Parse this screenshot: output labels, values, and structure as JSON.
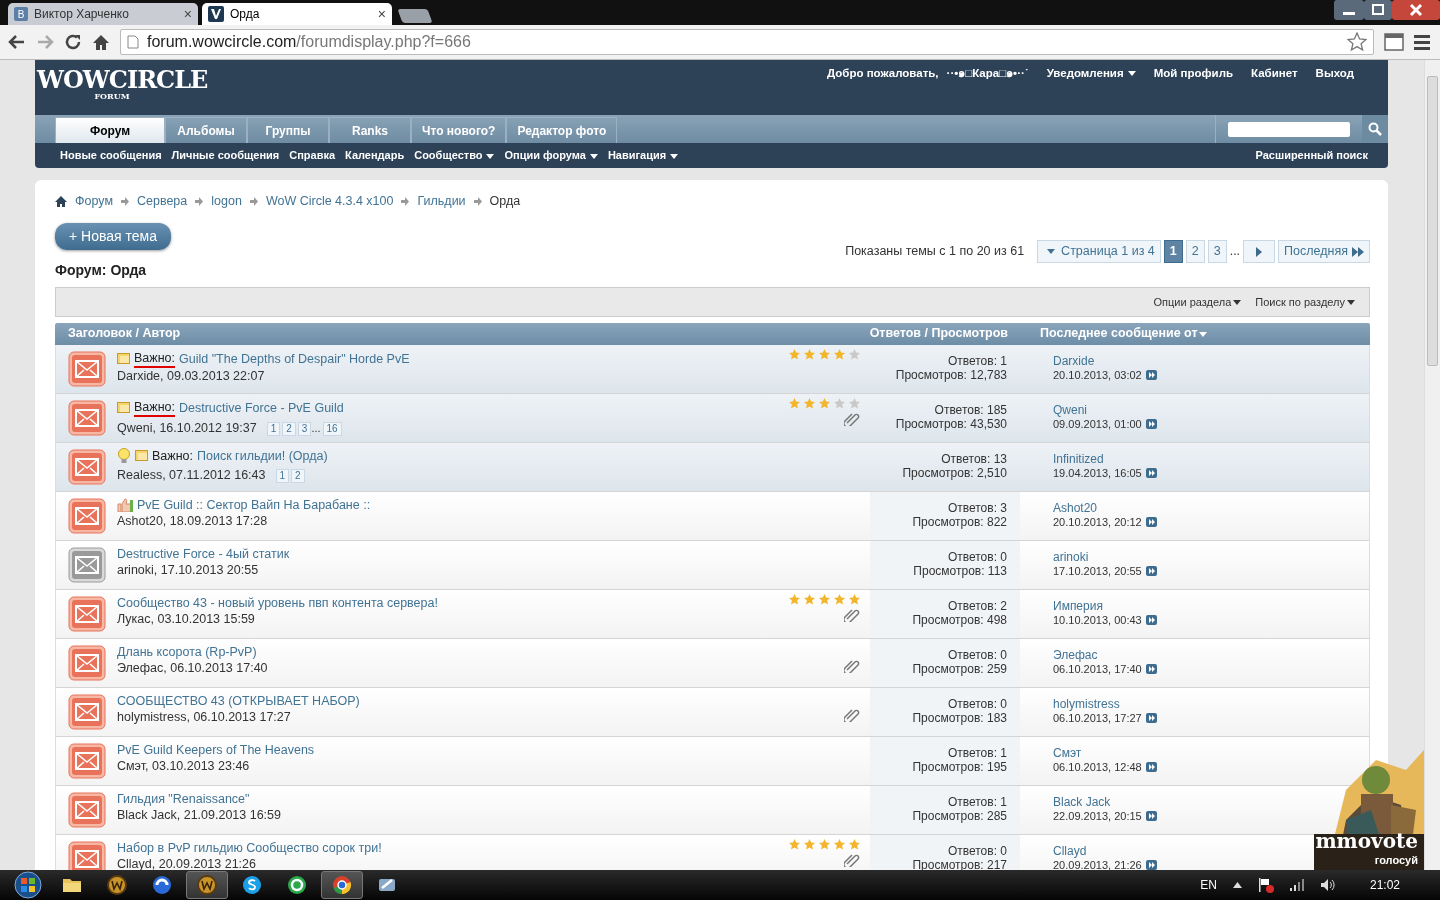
{
  "browser": {
    "tabs": [
      {
        "title": "Виктор Харченко",
        "icon_letter": "В",
        "selected": false
      },
      {
        "title": "Орда",
        "selected": true
      }
    ],
    "close_mark": "×",
    "url": {
      "host": "forum.wowcircle.com",
      "path": "/forumdisplay.php?f=666"
    }
  },
  "header": {
    "logo": "WOWCIRCLE",
    "logo_sub": "FORUM",
    "welcome": "Добро пожаловать,",
    "username": "··•๑□Кара□๑•··˙",
    "links": [
      {
        "label": "Уведомления",
        "dropdown": true
      },
      {
        "label": "Мой профиль",
        "dropdown": false
      },
      {
        "label": "Кабинет",
        "dropdown": false
      },
      {
        "label": "Выход",
        "dropdown": false
      }
    ]
  },
  "nav_tabs": [
    {
      "label": "Форум",
      "selected": true
    },
    {
      "label": "Альбомы",
      "selected": false
    },
    {
      "label": "Группы",
      "selected": false
    },
    {
      "label": "Ranks",
      "selected": false
    },
    {
      "label": "Что нового?",
      "selected": false
    },
    {
      "label": "Редактор фото",
      "selected": false
    }
  ],
  "subnav": [
    {
      "label": "Новые сообщения",
      "dropdown": false
    },
    {
      "label": "Личные сообщения",
      "dropdown": false
    },
    {
      "label": "Справка",
      "dropdown": false
    },
    {
      "label": "Календарь",
      "dropdown": false
    },
    {
      "label": "Сообщество",
      "dropdown": true
    },
    {
      "label": "Опции форума",
      "dropdown": true
    },
    {
      "label": "Навигация",
      "dropdown": true
    }
  ],
  "advanced_search": "Расширенный поиск",
  "breadcrumb": [
    "Форум",
    "Сервера",
    "logon",
    "WoW Circle 4.3.4 x100",
    "Гильдии",
    "Орда"
  ],
  "new_thread_button": "+ Новая тема",
  "forum_title": "Форум: Орда",
  "showing": "Показаны темы с 1 по 20 из 61",
  "pagination": {
    "page_menu": "Страница 1 из 4",
    "pages": [
      {
        "label": "1",
        "selected": true
      },
      {
        "label": "2",
        "selected": false
      },
      {
        "label": "3",
        "selected": false
      }
    ],
    "ellipsis": "...",
    "last": "Последняя"
  },
  "toolbar": [
    {
      "label": "Опции раздела"
    },
    {
      "label": "Поиск по разделу"
    }
  ],
  "columns": [
    "Заголовок / Автор",
    "Ответов / Просмотров",
    "Последнее сообщение от"
  ],
  "threads": [
    {
      "sticky": true,
      "read": false,
      "icons": [
        {
          "kind": "note"
        }
      ],
      "prefix": "Важно:",
      "underlined": true,
      "title": "Guild \"The Depths of Despair\" Horde PvE",
      "author": "Darxide, 09.03.2013 22:07",
      "stars": 4,
      "attachment": false,
      "replies": "Ответов: 1",
      "views": "Просмотров: 12,783",
      "last_user": "Darxide",
      "last_date": "20.10.2013, 03:02"
    },
    {
      "sticky": true,
      "read": false,
      "icons": [
        {
          "kind": "note"
        }
      ],
      "prefix": "Важно:",
      "underlined": true,
      "title": "Destructive Force - PvE Guild",
      "author": "Qweni, 16.10.2012 19:37",
      "pages": [
        {
          "label": "1",
          "kind": "page"
        },
        {
          "label": "2",
          "kind": "page"
        },
        {
          "label": "3",
          "kind": "page"
        },
        {
          "label": "...",
          "kind": "gap"
        },
        {
          "label": "16",
          "kind": "page"
        }
      ],
      "stars": 3,
      "attachment": true,
      "replies": "Ответов: 185",
      "views": "Просмотров: 43,530",
      "last_user": "Qweni",
      "last_date": "09.09.2013, 01:00"
    },
    {
      "sticky": true,
      "read": false,
      "icons": [
        {
          "kind": "bulb"
        },
        {
          "kind": "note"
        }
      ],
      "prefix": "Важно:",
      "underlined": false,
      "title": "Поиск гильдии! (Орда)",
      "author": "Realess, 07.11.2012 16:43",
      "pages": [
        {
          "label": "1",
          "kind": "page"
        },
        {
          "label": "2",
          "kind": "page"
        }
      ],
      "attachment": false,
      "replies": "Ответов: 13",
      "views": "Просмотров: 2,510",
      "last_user": "Infinitized",
      "last_date": "19.04.2013, 16:05"
    },
    {
      "sticky": false,
      "read": false,
      "icons": [
        {
          "kind": "thumb"
        }
      ],
      "title": "PvE Guild :: Сектор Вайп На Барабане ::",
      "author": "Ashot20, 18.09.2013 17:28",
      "attachment": false,
      "replies": "Ответов: 3",
      "views": "Просмотров: 822",
      "last_user": "Ashot20",
      "last_date": "20.10.2013, 20:12"
    },
    {
      "sticky": false,
      "read": true,
      "title": "Destructive Force - 4ый статик",
      "author": "arinoki, 17.10.2013 20:55",
      "attachment": false,
      "replies": "Ответов: 0",
      "views": "Просмотров: 113",
      "last_user": "arinoki",
      "last_date": "17.10.2013, 20:55"
    },
    {
      "sticky": false,
      "read": false,
      "title": "Сообщество 43 - новый уровень пвп контента сервера!",
      "author": "Лукас, 03.10.2013 15:59",
      "stars": 5,
      "attachment": true,
      "replies": "Ответов: 2",
      "views": "Просмотров: 498",
      "last_user": "Империя",
      "last_date": "10.10.2013, 00:43"
    },
    {
      "sticky": false,
      "read": false,
      "title": "Длань ксорота (Rp-PvP)",
      "author": "Элефас, 06.10.2013 17:40",
      "attachment": true,
      "replies": "Ответов: 0",
      "views": "Просмотров: 259",
      "last_user": "Элефас",
      "last_date": "06.10.2013, 17:40"
    },
    {
      "sticky": false,
      "read": false,
      "title": "СООБЩЕСТВО 43 (ОТКРЫВАЕТ НАБОР)",
      "author": "holymistress, 06.10.2013 17:27",
      "attachment": true,
      "replies": "Ответов: 0",
      "views": "Просмотров: 183",
      "last_user": "holymistress",
      "last_date": "06.10.2013, 17:27"
    },
    {
      "sticky": false,
      "read": false,
      "title": "PvE Guild Keepers of The Heavens",
      "author": "Смэт, 03.10.2013 23:46",
      "attachment": false,
      "replies": "Ответов: 1",
      "views": "Просмотров: 195",
      "last_user": "Смэт",
      "last_date": "06.10.2013, 12:48"
    },
    {
      "sticky": false,
      "read": false,
      "title": "Гильдия \"Renaissance\"",
      "author": "Black Jack, 21.09.2013 16:59",
      "attachment": false,
      "replies": "Ответов: 1",
      "views": "Просмотров: 285",
      "last_user": "Black Jack",
      "last_date": "22.09.2013, 20:15"
    },
    {
      "sticky": false,
      "read": false,
      "title": "Набор в PvP гильдию Сообщество сорок три!",
      "author": "Cllayd, 20.09.2013 21:26",
      "stars": 5,
      "attachment": true,
      "replies": "Ответов: 0",
      "views": "Просмотров: 217",
      "last_user": "Cllayd",
      "last_date": "20.09.2013, 21:26"
    }
  ],
  "ad": {
    "brand": "mmovote",
    "call": "голосуй"
  },
  "taskbar": {
    "apps": [
      {
        "kind": "folder",
        "selected": false
      },
      {
        "kind": "gold",
        "selected": false
      },
      {
        "kind": "blue",
        "selected": false
      },
      {
        "kind": "gold",
        "selected": true
      },
      {
        "kind": "skype",
        "selected": false
      },
      {
        "kind": "green",
        "selected": false
      },
      {
        "kind": "chrome",
        "selected": true
      },
      {
        "kind": "tool",
        "selected": false
      }
    ],
    "lang": "EN",
    "time": "21:02"
  }
}
